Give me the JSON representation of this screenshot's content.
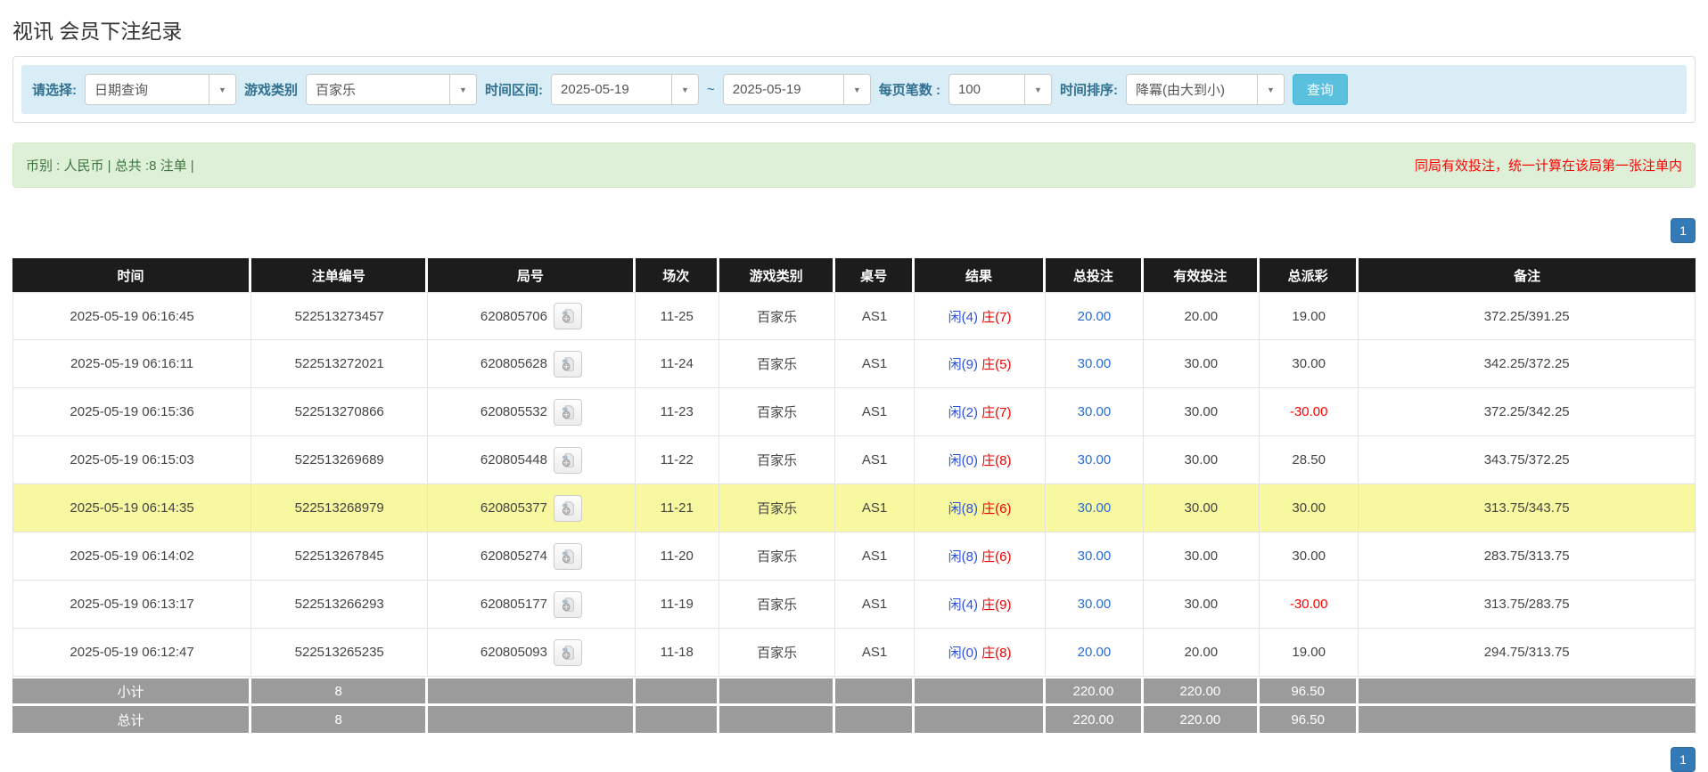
{
  "page": {
    "title": "视讯 会员下注纪录"
  },
  "filters": {
    "mode_label": "请选择:",
    "mode_value": "日期查询",
    "game_type_label": "游戏类别",
    "game_type_value": "百家乐",
    "time_range_label": "时间区间:",
    "date_from": "2025-05-19",
    "tilde": "~",
    "date_to": "2025-05-19",
    "page_size_label": "每页笔数 :",
    "page_size_value": "100",
    "sort_label": "时间排序:",
    "sort_value": "降冪(由大到小)",
    "search_button": "查询"
  },
  "summary_bar": {
    "left_text": "币别 : 人民币 | 总共 :8 注单 |",
    "right_note": "同局有效投注，统一计算在该局第一张注单内"
  },
  "pagination": {
    "page": "1"
  },
  "table": {
    "headers": [
      "时间",
      "注单编号",
      "局号",
      "场次",
      "游戏类别",
      "桌号",
      "结果",
      "总投注",
      "有效投注",
      "总派彩",
      "备注"
    ],
    "rows": [
      {
        "time": "2025-05-19 06:16:45",
        "bet_id": "522513273457",
        "round_id": "620805706",
        "session": "11-25",
        "game": "百家乐",
        "table_no": "AS1",
        "result_player": "闲(4)",
        "result_banker": "庄(7)",
        "total_bet": "20.00",
        "valid_bet": "20.00",
        "payout": "19.00",
        "remark": "372.25/391.25",
        "highlight": false
      },
      {
        "time": "2025-05-19 06:16:11",
        "bet_id": "522513272021",
        "round_id": "620805628",
        "session": "11-24",
        "game": "百家乐",
        "table_no": "AS1",
        "result_player": "闲(9)",
        "result_banker": "庄(5)",
        "total_bet": "30.00",
        "valid_bet": "30.00",
        "payout": "30.00",
        "remark": "342.25/372.25",
        "highlight": false
      },
      {
        "time": "2025-05-19 06:15:36",
        "bet_id": "522513270866",
        "round_id": "620805532",
        "session": "11-23",
        "game": "百家乐",
        "table_no": "AS1",
        "result_player": "闲(2)",
        "result_banker": "庄(7)",
        "total_bet": "30.00",
        "valid_bet": "30.00",
        "payout": "-30.00",
        "remark": "372.25/342.25",
        "highlight": false
      },
      {
        "time": "2025-05-19 06:15:03",
        "bet_id": "522513269689",
        "round_id": "620805448",
        "session": "11-22",
        "game": "百家乐",
        "table_no": "AS1",
        "result_player": "闲(0)",
        "result_banker": "庄(8)",
        "total_bet": "30.00",
        "valid_bet": "30.00",
        "payout": "28.50",
        "remark": "343.75/372.25",
        "highlight": false
      },
      {
        "time": "2025-05-19 06:14:35",
        "bet_id": "522513268979",
        "round_id": "620805377",
        "session": "11-21",
        "game": "百家乐",
        "table_no": "AS1",
        "result_player": "闲(8)",
        "result_banker": "庄(6)",
        "total_bet": "30.00",
        "valid_bet": "30.00",
        "payout": "30.00",
        "remark": "313.75/343.75",
        "highlight": true
      },
      {
        "time": "2025-05-19 06:14:02",
        "bet_id": "522513267845",
        "round_id": "620805274",
        "session": "11-20",
        "game": "百家乐",
        "table_no": "AS1",
        "result_player": "闲(8)",
        "result_banker": "庄(6)",
        "total_bet": "30.00",
        "valid_bet": "30.00",
        "payout": "30.00",
        "remark": "283.75/313.75",
        "highlight": false
      },
      {
        "time": "2025-05-19 06:13:17",
        "bet_id": "522513266293",
        "round_id": "620805177",
        "session": "11-19",
        "game": "百家乐",
        "table_no": "AS1",
        "result_player": "闲(4)",
        "result_banker": "庄(9)",
        "total_bet": "30.00",
        "valid_bet": "30.00",
        "payout": "-30.00",
        "remark": "313.75/283.75",
        "highlight": false
      },
      {
        "time": "2025-05-19 06:12:47",
        "bet_id": "522513265235",
        "round_id": "620805093",
        "session": "11-18",
        "game": "百家乐",
        "table_no": "AS1",
        "result_player": "闲(0)",
        "result_banker": "庄(8)",
        "total_bet": "20.00",
        "valid_bet": "20.00",
        "payout": "19.00",
        "remark": "294.75/313.75",
        "highlight": false
      }
    ],
    "subtotal": {
      "label": "小计",
      "count": "8",
      "total_bet": "220.00",
      "valid_bet": "220.00",
      "payout": "96.50"
    },
    "total": {
      "label": "总计",
      "count": "8",
      "total_bet": "220.00",
      "valid_bet": "220.00",
      "payout": "96.50"
    }
  },
  "colors": {
    "header_bg": "#1c1c1c",
    "highlight": "#f8f8a0",
    "gray_row": "#9b9b9b",
    "info_bg": "#d9edf7",
    "label_blue": "#31708f",
    "green_bg": "#dff0d8",
    "green_text": "#3c763d",
    "note_red": "#ff0000",
    "link_blue": "#2a6bd8",
    "player_blue": "#2b50e0",
    "banker_red": "#f00000",
    "button_blue": "#5bc0de",
    "pagination_blue": "#337ab7",
    "neg_red": "#ff0000"
  }
}
